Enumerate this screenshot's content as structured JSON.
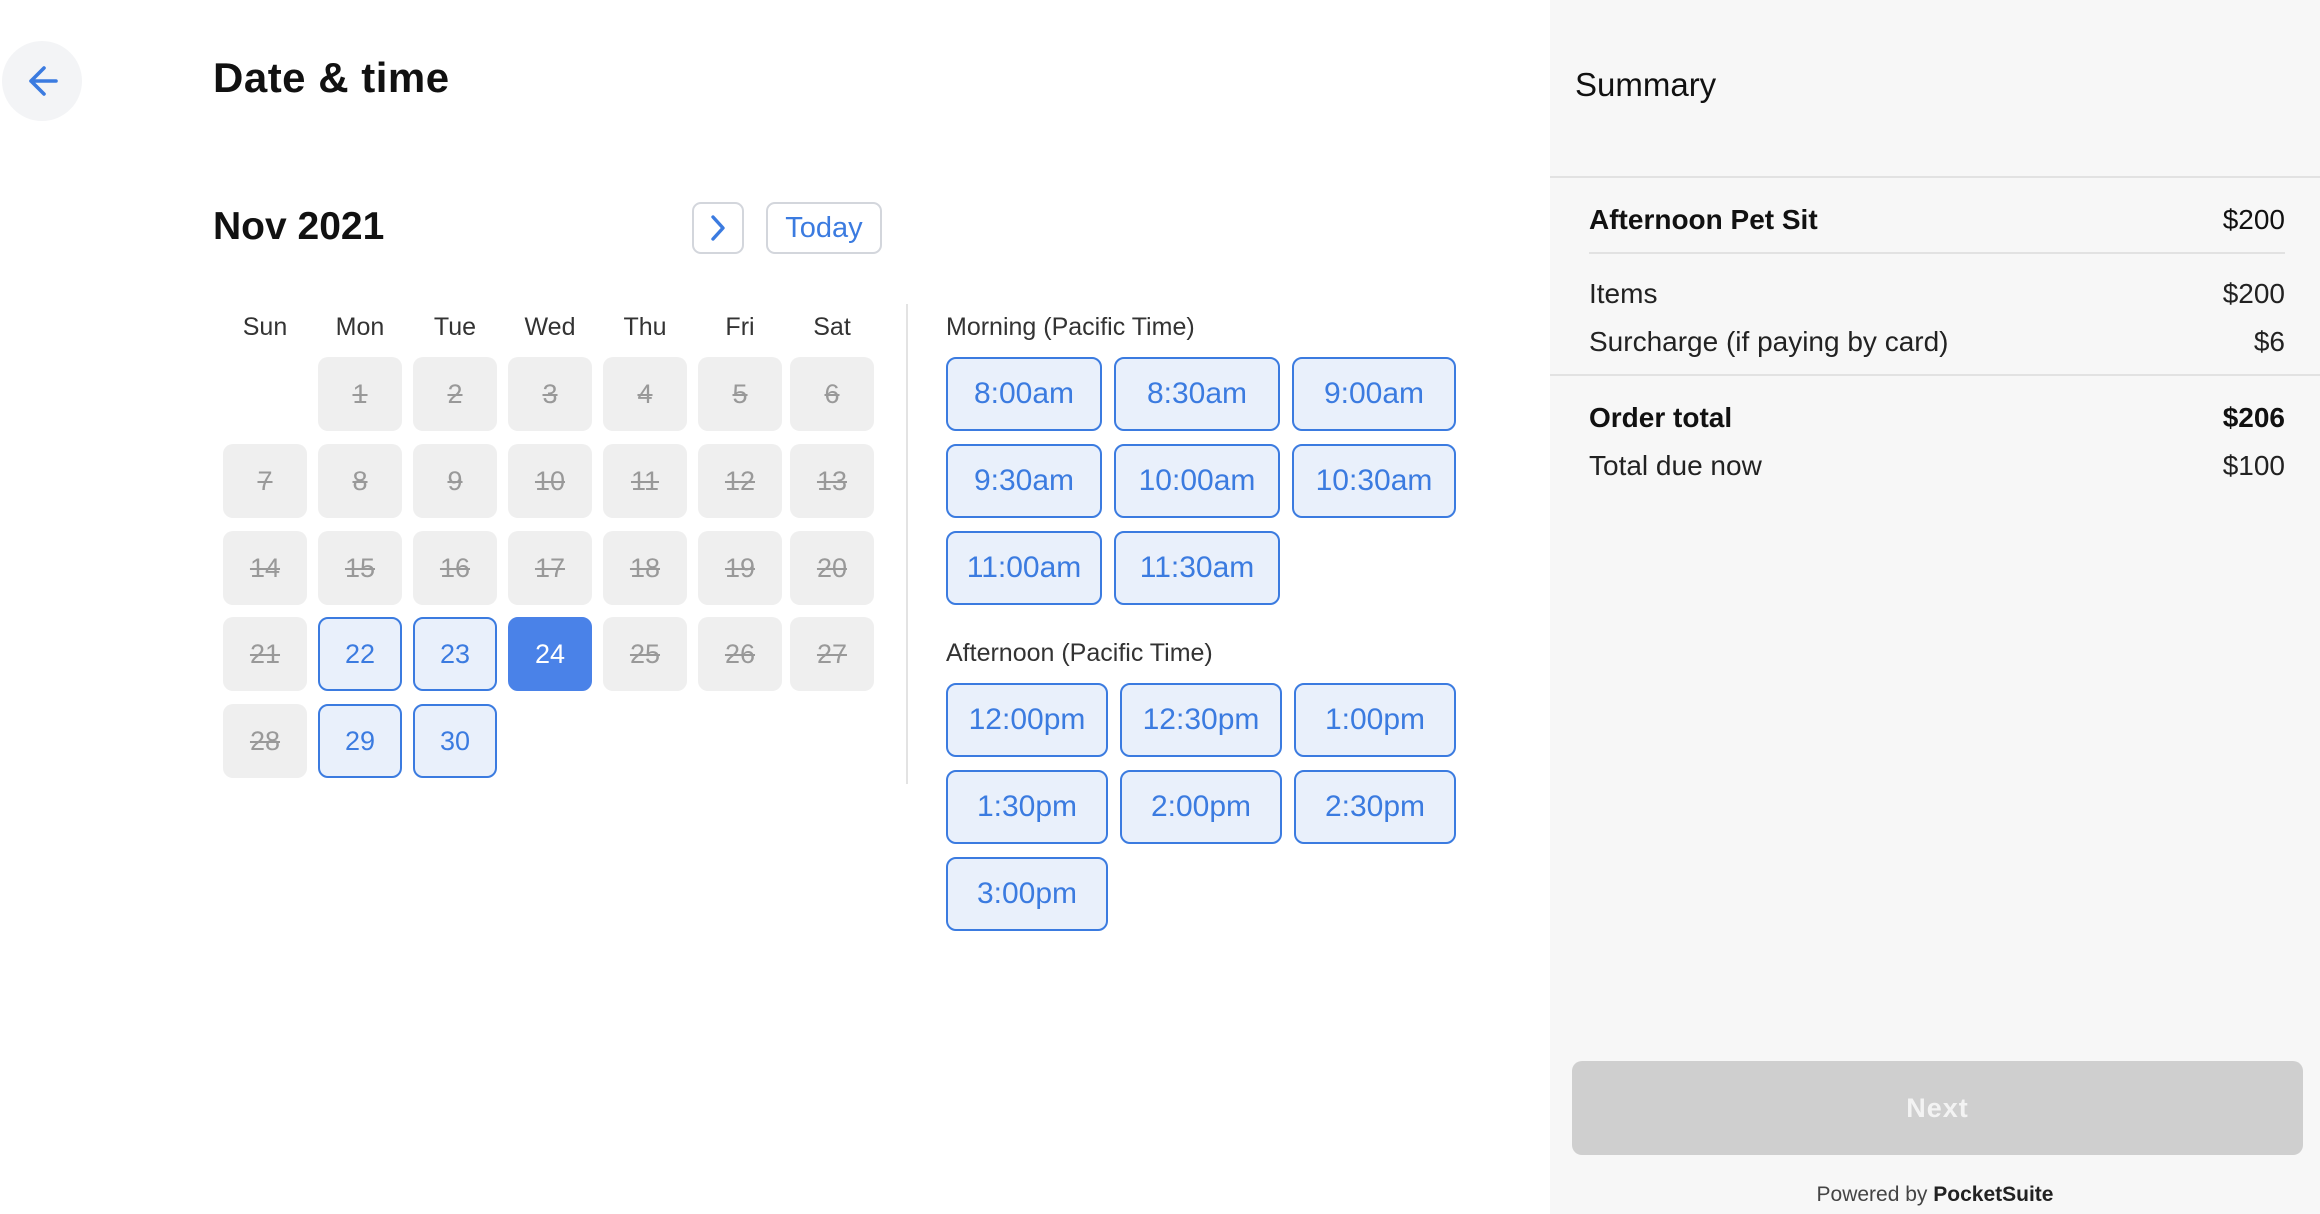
{
  "header": {
    "title": "Date & time",
    "back_icon": "arrow-left-icon"
  },
  "calendar": {
    "month_label": "Nov 2021",
    "next_icon": "chevron-right-icon",
    "today_label": "Today",
    "weekdays": [
      "Sun",
      "Mon",
      "Tue",
      "Wed",
      "Thu",
      "Fri",
      "Sat"
    ],
    "first_weekday_index": 1,
    "days": [
      {
        "label": "1",
        "state": "disabled"
      },
      {
        "label": "2",
        "state": "disabled"
      },
      {
        "label": "3",
        "state": "disabled"
      },
      {
        "label": "4",
        "state": "disabled"
      },
      {
        "label": "5",
        "state": "disabled"
      },
      {
        "label": "6",
        "state": "disabled"
      },
      {
        "label": "7",
        "state": "disabled"
      },
      {
        "label": "8",
        "state": "disabled"
      },
      {
        "label": "9",
        "state": "disabled"
      },
      {
        "label": "10",
        "state": "disabled"
      },
      {
        "label": "11",
        "state": "disabled"
      },
      {
        "label": "12",
        "state": "disabled"
      },
      {
        "label": "13",
        "state": "disabled"
      },
      {
        "label": "14",
        "state": "disabled"
      },
      {
        "label": "15",
        "state": "disabled"
      },
      {
        "label": "16",
        "state": "disabled"
      },
      {
        "label": "17",
        "state": "disabled"
      },
      {
        "label": "18",
        "state": "disabled"
      },
      {
        "label": "19",
        "state": "disabled"
      },
      {
        "label": "20",
        "state": "disabled"
      },
      {
        "label": "21",
        "state": "disabled"
      },
      {
        "label": "22",
        "state": "available"
      },
      {
        "label": "23",
        "state": "available"
      },
      {
        "label": "24",
        "state": "selected"
      },
      {
        "label": "25",
        "state": "disabled"
      },
      {
        "label": "26",
        "state": "disabled"
      },
      {
        "label": "27",
        "state": "disabled"
      },
      {
        "label": "28",
        "state": "disabled"
      },
      {
        "label": "29",
        "state": "available"
      },
      {
        "label": "30",
        "state": "available"
      }
    ]
  },
  "slots": {
    "morning_heading": "Morning (Pacific Time)",
    "morning": [
      "8:00am",
      "8:30am",
      "9:00am",
      "9:30am",
      "10:00am",
      "10:30am",
      "11:00am",
      "11:30am"
    ],
    "afternoon_heading": "Afternoon (Pacific Time)",
    "afternoon": [
      "12:00pm",
      "12:30pm",
      "1:00pm",
      "1:30pm",
      "2:00pm",
      "2:30pm",
      "3:00pm"
    ]
  },
  "summary": {
    "title": "Summary",
    "service_name": "Afternoon Pet Sit",
    "service_price": "$200",
    "items_label": "Items",
    "items_value": "$200",
    "surcharge_label": "Surcharge (if paying by card)",
    "surcharge_value": "$6",
    "order_total_label": "Order total",
    "order_total_value": "$206",
    "due_now_label": "Total due now",
    "due_now_value": "$100",
    "next_label": "Next",
    "powered_prefix": "Powered by",
    "powered_brand": "PocketSuite"
  },
  "colors": {
    "accent": "#3b7be0",
    "selected": "#4a82e8",
    "disabled_bg": "#efefef",
    "sidebar_bg": "#f7f7f7"
  }
}
